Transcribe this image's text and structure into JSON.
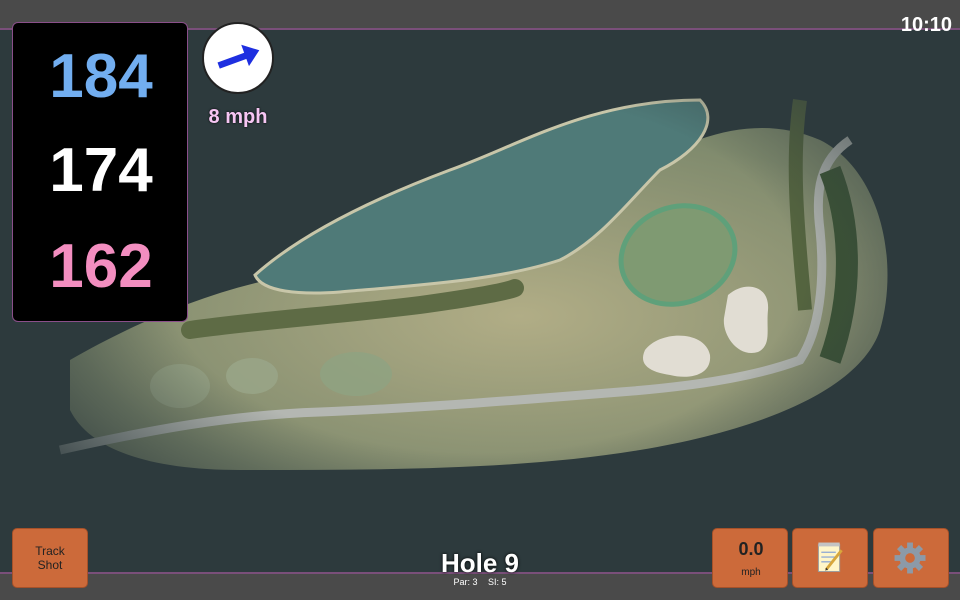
{
  "clock": "10:10",
  "distances": {
    "back": "184",
    "center": "174",
    "front": "162"
  },
  "wind": {
    "speed": "8 mph",
    "icon": "wind-arrow-icon",
    "arrow_color": "#1e2fe0"
  },
  "buttons": {
    "track_shot": "Track Shot",
    "speed_value": "0.0",
    "speed_unit": "mph",
    "notes_icon": "notepad-icon",
    "settings_icon": "gear-icon"
  },
  "hole": {
    "title": "Hole 9",
    "par": "Par: 3",
    "si": "SI: 5"
  },
  "colors": {
    "back": "#72aef0",
    "center": "#ffffff",
    "front": "#f38ec0",
    "button": "#cc6a3a",
    "border_accent": "#8a4f8a"
  }
}
